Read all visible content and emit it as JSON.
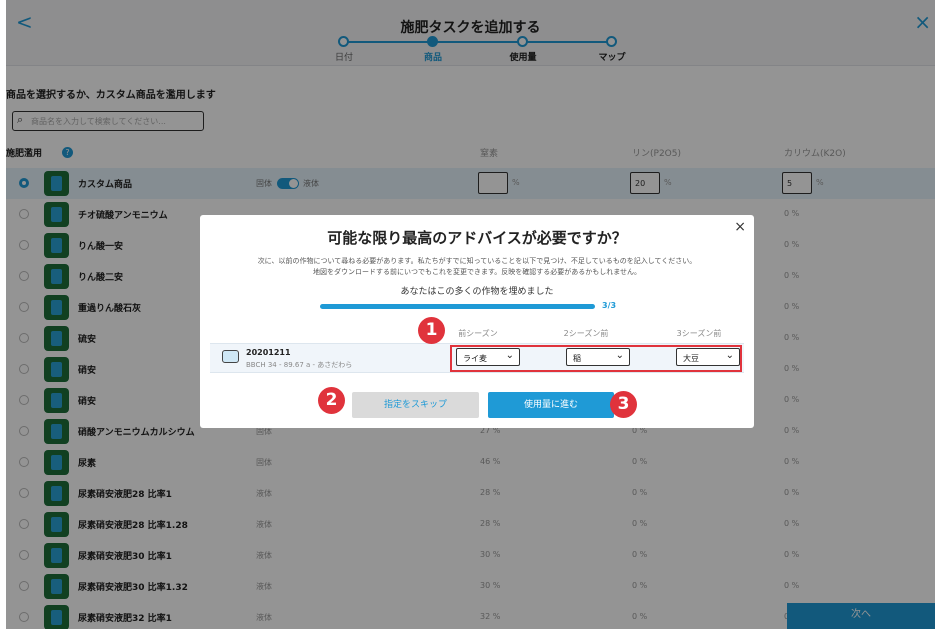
{
  "header": {
    "back": "<",
    "close": "×",
    "title": "施肥タスクを追加する"
  },
  "steps": [
    {
      "label": "日付",
      "active": false
    },
    {
      "label": "商品",
      "active": true
    },
    {
      "label": "使用量",
      "active": false
    },
    {
      "label": "マップ",
      "active": false
    }
  ],
  "subtitle": "商品を選択するか、カスタム商品を濫用します",
  "search": {
    "placeholder": "商品名を入力して検索してください..."
  },
  "list_header": {
    "name": "施肥濫用",
    "n": "窒素",
    "p": "リン(P2O5)",
    "k": "カリウム(K2O)"
  },
  "custom_row": {
    "name": "カスタム商品",
    "form_a": "固体",
    "form_b": "液体",
    "n_value": "",
    "p_value": "20",
    "k_value": "5",
    "pct": "%"
  },
  "products": [
    {
      "name": "チオ硫酸アンモニウム",
      "form": "",
      "n": "",
      "p": "",
      "k": "0 %"
    },
    {
      "name": "りん酸一安",
      "form": "",
      "n": "",
      "p": "",
      "k": "0 %"
    },
    {
      "name": "りん酸二安",
      "form": "",
      "n": "",
      "p": "",
      "k": "0 %"
    },
    {
      "name": "重過りん酸石灰",
      "form": "",
      "n": "",
      "p": "",
      "k": "0 %"
    },
    {
      "name": "硫安",
      "form": "",
      "n": "",
      "p": "",
      "k": "0 %"
    },
    {
      "name": "硝安",
      "form": "",
      "n": "",
      "p": "",
      "k": "0 %"
    },
    {
      "name": "硝安",
      "form": "",
      "n": "",
      "p": "",
      "k": "0 %"
    },
    {
      "name": "硝酸アンモニウムカルシウム",
      "form": "固体",
      "n": "27 %",
      "p": "0 %",
      "k": "0 %"
    },
    {
      "name": "尿素",
      "form": "固体",
      "n": "46 %",
      "p": "0 %",
      "k": "0 %"
    },
    {
      "name": "尿素硝安液肥28 比率1",
      "form": "液体",
      "n": "28 %",
      "p": "0 %",
      "k": "0 %"
    },
    {
      "name": "尿素硝安液肥28 比率1.28",
      "form": "液体",
      "n": "28 %",
      "p": "0 %",
      "k": "0 %"
    },
    {
      "name": "尿素硝安液肥30 比率1",
      "form": "液体",
      "n": "30 %",
      "p": "0 %",
      "k": "0 %"
    },
    {
      "name": "尿素硝安液肥30 比率1.32",
      "form": "液体",
      "n": "30 %",
      "p": "0 %",
      "k": "0 %"
    },
    {
      "name": "尿素硝安液肥32 比率1",
      "form": "液体",
      "n": "32 %",
      "p": "0 %",
      "k": "0"
    }
  ],
  "next_button": "次へ",
  "modal": {
    "title": "可能な限り最高のアドバイスが必要ですか？",
    "desc_line1": "次に、以前の作物について尋ねる必要があります。私たちがすでに知っていることを以下で見つけ、不足しているものを記入してください。",
    "desc_line2": "地図をダウンロードする前にいつでもこれを変更できます。反映を確認する必要があるかもしれません。",
    "crops_label": "あなたはこの多くの作物を埋めました",
    "progress_text": "3/3",
    "progress_fraction": 1.0,
    "columns": [
      "前シーズン",
      "2シーズン前",
      "3シーズン前"
    ],
    "field": {
      "name": "20201211",
      "info": "BBCH 34 - 89.67 a - あさだわら"
    },
    "selects": [
      "ライ麦",
      "稲",
      "大豆"
    ],
    "skip_button": "指定をスキップ",
    "proceed_button": "使用量に進む",
    "close": "×"
  },
  "annotations": [
    "1",
    "2",
    "3"
  ],
  "colors": {
    "accent": "#1f9ad6",
    "annotation": "#e0333c",
    "dark_green": "#1e6f3a"
  }
}
